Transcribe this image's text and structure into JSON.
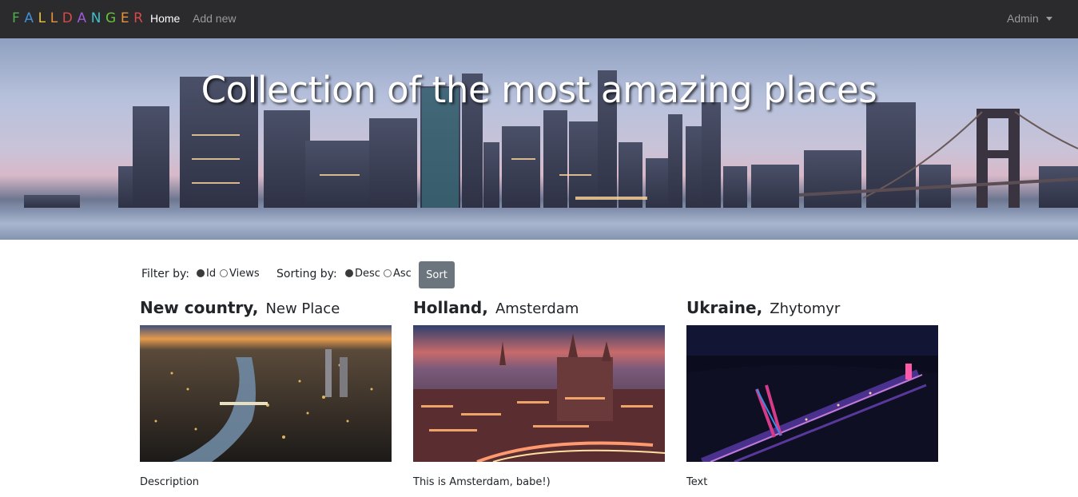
{
  "navbar": {
    "brand_letters": [
      "F",
      "A",
      "L",
      "L",
      "D",
      "A",
      "N",
      "G",
      "E",
      "R"
    ],
    "brand_colors": [
      "#4caf50",
      "#3f8fd6",
      "#e8c23a",
      "#e8913a",
      "#d64a4a",
      "#9c5ad6",
      "#3fc1c9",
      "#67c23a",
      "#e8913a",
      "#d64a4a"
    ],
    "home": "Home",
    "add_new": "Add new",
    "admin": "Admin"
  },
  "hero": {
    "title": "Collection of the most amazing places"
  },
  "controls": {
    "filter_label": "Filter by:",
    "filter_options": [
      {
        "label": "Id",
        "checked": true
      },
      {
        "label": "Views",
        "checked": false
      }
    ],
    "sort_label": "Sorting by:",
    "sort_options": [
      {
        "label": "Desc",
        "checked": true
      },
      {
        "label": "Asc",
        "checked": false
      }
    ],
    "sort_button": "Sort"
  },
  "places": [
    {
      "country": "New country",
      "city": "New Place",
      "description": "Description"
    },
    {
      "country": "Holland",
      "city": "Amsterdam",
      "description": "This is Amsterdam, babe!)"
    },
    {
      "country": "Ukraine",
      "city": "Zhytomyr",
      "description": "Text"
    }
  ]
}
